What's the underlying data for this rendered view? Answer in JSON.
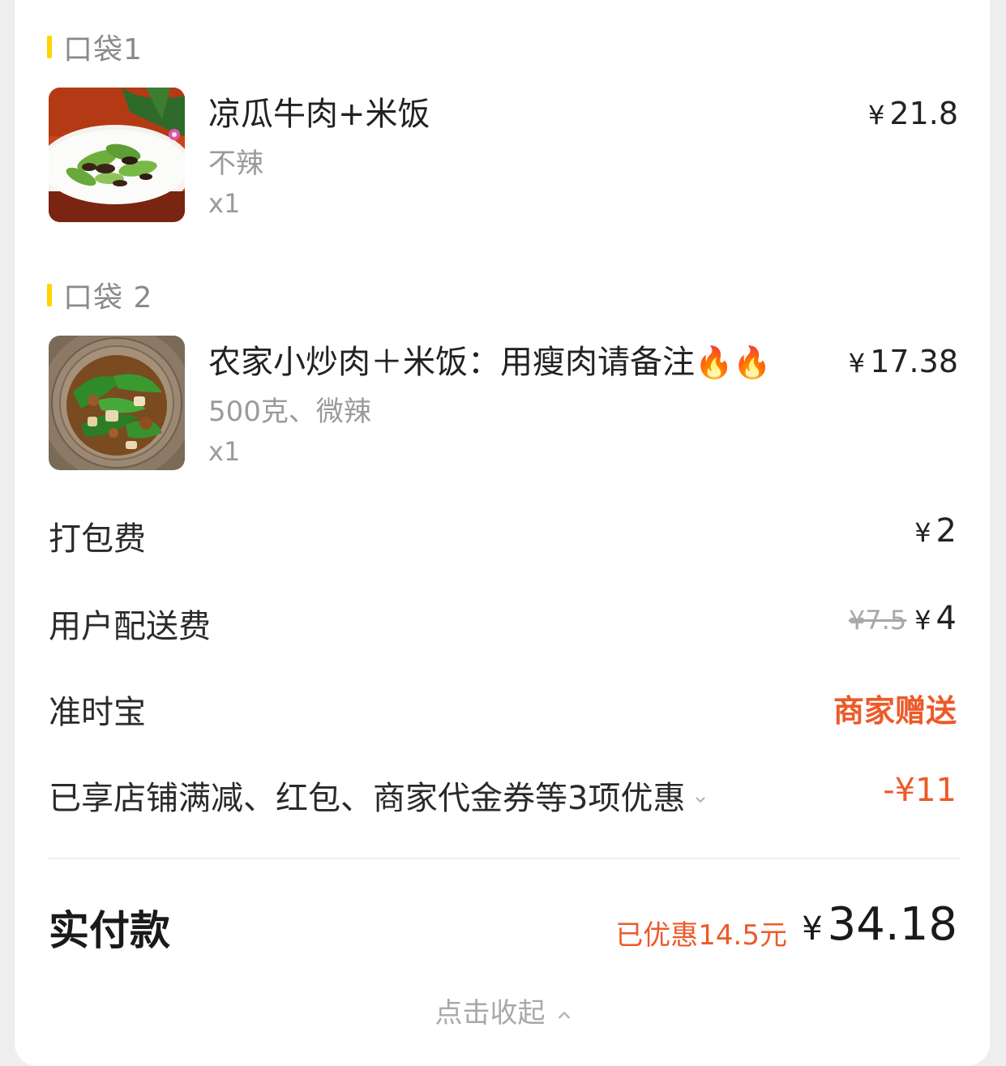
{
  "pockets": [
    {
      "title": "口袋1",
      "item": {
        "name": "凉瓜牛肉+米饭",
        "spec": "不辣",
        "qty": "x1",
        "currency": "¥",
        "price": "21.8",
        "image": "food-photo-bitter-melon-beef"
      }
    },
    {
      "title": "口袋 2",
      "item": {
        "name": "农家小炒肉＋米饭：用瘦肉请备注",
        "name_emoji": "🔥🔥",
        "spec": "500克、微辣",
        "qty": "x1",
        "currency": "¥",
        "price": "17.38",
        "image": "food-photo-stir-fried-pork"
      }
    }
  ],
  "fees": {
    "packing": {
      "label": "打包费",
      "currency": "¥",
      "value": "2"
    },
    "delivery": {
      "label": "用户配送费",
      "original": "¥7.5",
      "currency": "¥",
      "value": "4"
    },
    "ontime": {
      "label": "准时宝",
      "value": "商家赠送"
    },
    "discount": {
      "label": "已享店铺满减、红包、商家代金券等3项优惠",
      "value": "-¥11"
    }
  },
  "total": {
    "label": "实付款",
    "saved": "已优惠14.5元",
    "currency": "¥",
    "amount": "34.18"
  },
  "collapse_label": "点击收起",
  "colors": {
    "accent_yellow": "#ffd400",
    "discount_red": "#ec5a2a"
  }
}
